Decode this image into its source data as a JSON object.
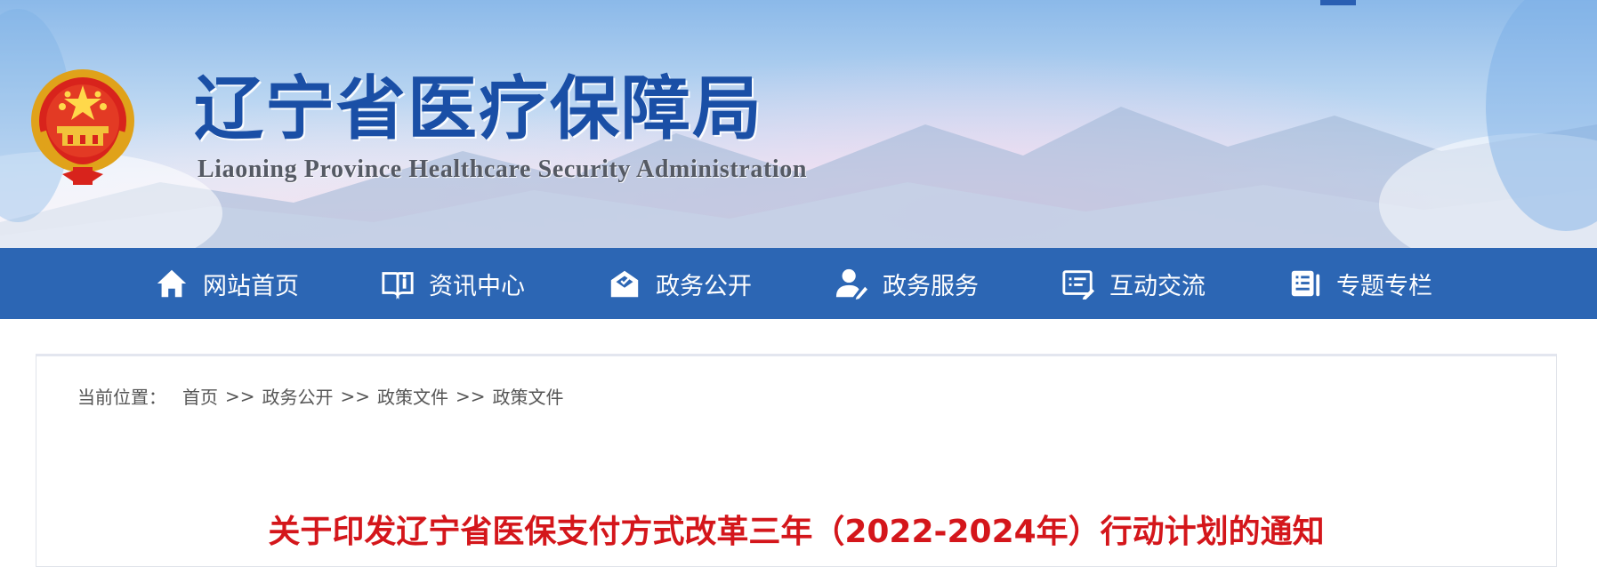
{
  "header": {
    "title_cn": "辽宁省医疗保障局",
    "title_en": "Liaoning Province Healthcare Security Administration"
  },
  "nav": {
    "items": [
      {
        "label": "网站首页",
        "icon": "home-icon"
      },
      {
        "label": "资讯中心",
        "icon": "book-icon"
      },
      {
        "label": "政务公开",
        "icon": "mail-open-icon"
      },
      {
        "label": "政务服务",
        "icon": "user-service-icon"
      },
      {
        "label": "互动交流",
        "icon": "message-edit-icon"
      },
      {
        "label": "专题专栏",
        "icon": "column-doc-icon"
      }
    ]
  },
  "breadcrumb": {
    "label": "当前位置：",
    "separator": ">>",
    "items": [
      "首页",
      "政务公开",
      "政策文件",
      "政策文件"
    ]
  },
  "article": {
    "title": "关于印发辽宁省医保支付方式改革三年（2022-2024年）行动计划的通知"
  },
  "colors": {
    "nav_background": "#2c66b4",
    "title_blue": "#1a4fa6",
    "article_title_red": "#d4161b"
  }
}
